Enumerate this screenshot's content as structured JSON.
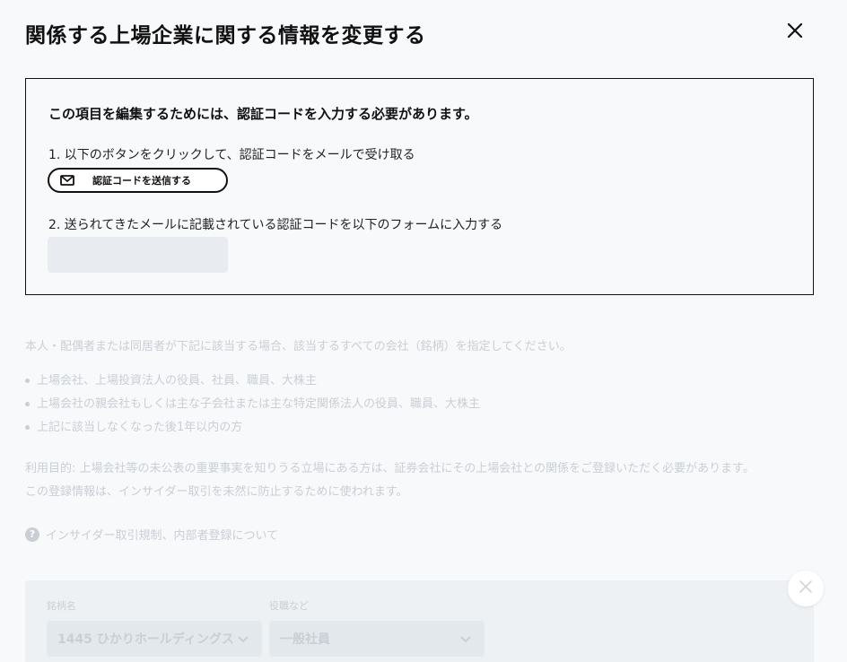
{
  "modal": {
    "title": "関係する上場企業に関する情報を変更する"
  },
  "verification": {
    "heading": "この項目を編集するためには、認証コードを入力する必要があります。",
    "step1": "1. 以下のボタンをクリックして、認証コードをメールで受け取る",
    "send_button_label": "認証コードを送信する",
    "step2": "2. 送られてきたメールに記載されている認証コードを以下のフォームに入力する",
    "code_input_value": "",
    "code_input_placeholder": ""
  },
  "content": {
    "intro": "本人・配偶者または同居者が下記に該当する場合、該当するすべての会社（銘柄）を指定してください。",
    "bullets": [
      "上場会社、上場投資法人の役員、社員、職員、大株主",
      "上場会社の親会社もしくは主な子会社または主な特定関係法人の役員、職員、大株主",
      "上記に該当しなくなった後1年以内の方"
    ],
    "purpose_line1": "利用目的: 上場会社等の未公表の重要事実を知りうる立場にある方は、証券会社にその上場会社との関係をご登録いただく必要があります。",
    "purpose_line2": "この登録情報は、インサイダー取引を未然に防止するために使われます。",
    "help_link": "インサイダー取引規制、内部者登録について",
    "help_icon_glyph": "?"
  },
  "form": {
    "stock_label": "銘柄名",
    "stock_value": "1445 ひかりホールディングス",
    "role_label": "役職など",
    "role_value": "一般社員"
  },
  "icons": {
    "close": "close-icon",
    "mail": "mail-icon",
    "help": "question-circle-icon",
    "chevron": "chevron-down-icon",
    "remove": "close-icon"
  },
  "colors": {
    "background": "#f8f9fb",
    "text": "#111111",
    "faded_text": "#c9cfd5",
    "input_bg": "#e8ecf0"
  }
}
